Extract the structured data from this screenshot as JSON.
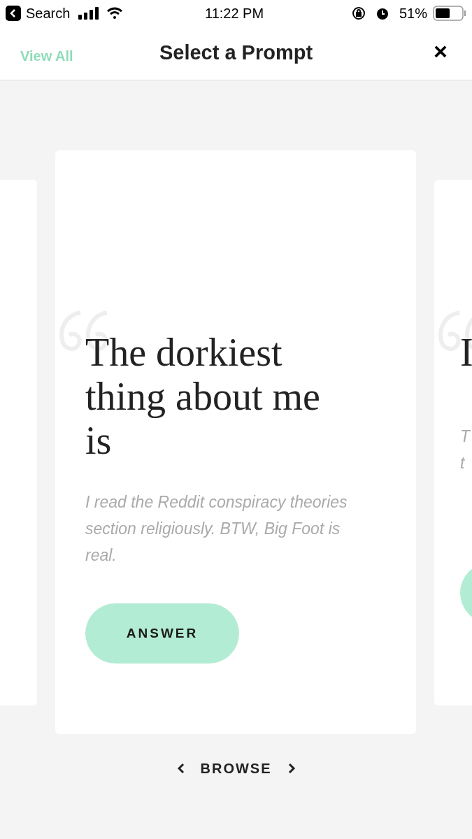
{
  "status_bar": {
    "back_label": "Search",
    "time": "11:22 PM",
    "battery": "51%"
  },
  "nav": {
    "left": "View All",
    "title": "Select a Prompt",
    "close": "×"
  },
  "cards": [
    {
      "kind": "blank"
    },
    {
      "kind": "full",
      "title": "The dorkiest thing about me is",
      "answer": "I read the Reddit conspiracy theories section religiously. BTW, Big Foot is real.",
      "button": "ANSWER"
    },
    {
      "kind": "partial",
      "title_lines": [
        "I"
      ],
      "answer_lines": [
        "T",
        "t"
      ]
    }
  ],
  "browse": {
    "label": "BROWSE"
  }
}
